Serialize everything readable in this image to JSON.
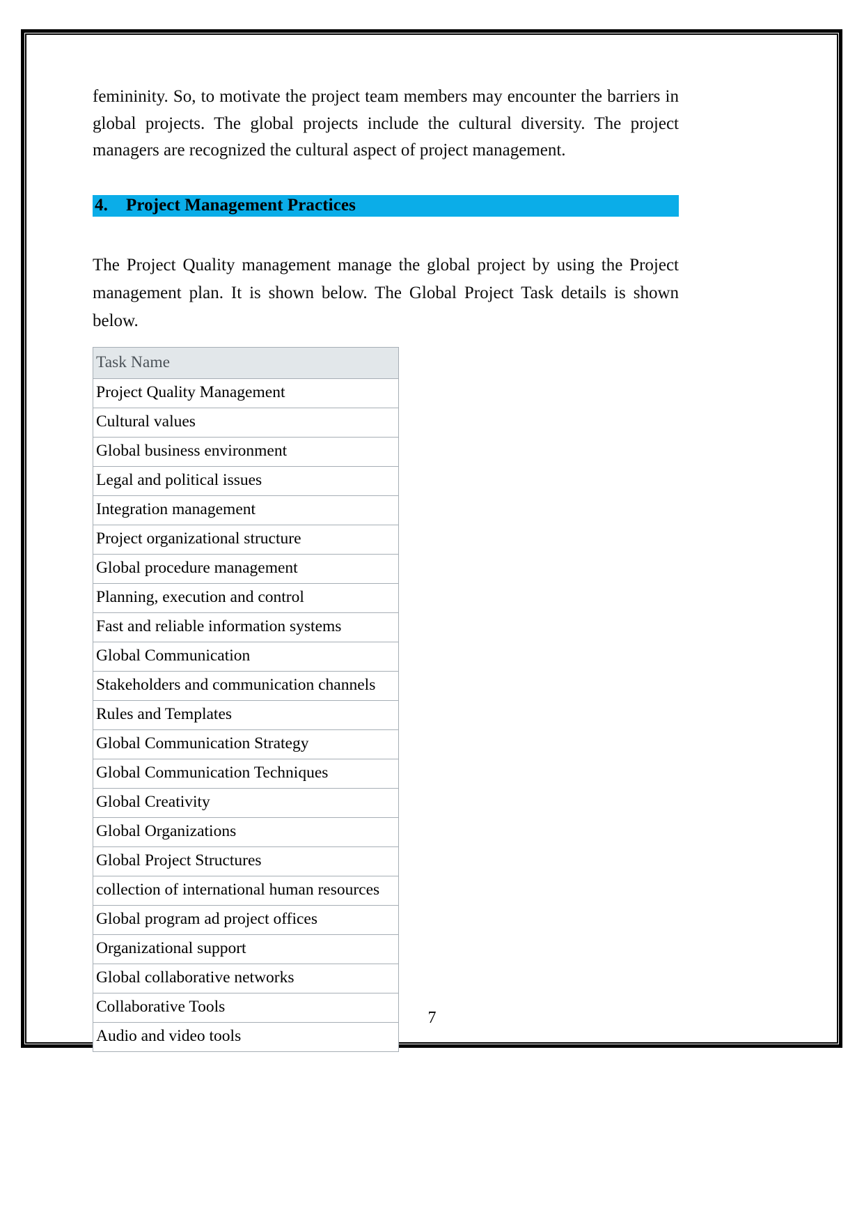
{
  "document": {
    "paragraphs": {
      "top": "femininity. So, to motivate the project team members may encounter the barriers in global projects. The global projects include the cultural diversity. The project managers are recognized the cultural aspect of project management.",
      "intro": "The Project Quality management manage the global project by using the Project management plan. It is shown below. The Global Project Task details is shown below."
    },
    "heading": {
      "number": "4.",
      "text": "Project Management Practices",
      "highlight_color": "#0BADE8"
    },
    "page_number": "7"
  },
  "task_table": {
    "header": "Task Name",
    "header_background": "#E2E7EA",
    "header_text_color": "#4A5157",
    "border_color": "#A6AEB5",
    "rows": [
      {
        "label": "Project Quality Management",
        "level": 0,
        "bold": true
      },
      {
        "label": "Cultural values",
        "level": 1,
        "bold": false
      },
      {
        "label": "Global business environment",
        "level": 1,
        "bold": false
      },
      {
        "label": "Legal and political issues",
        "level": 1,
        "bold": false
      },
      {
        "label": "Integration management",
        "level": 1,
        "bold": false
      },
      {
        "label": "Project organizational structure",
        "level": 1,
        "bold": false
      },
      {
        "label": "Global procedure management",
        "level": 1,
        "bold": false
      },
      {
        "label": "Planning, execution and control",
        "level": 1,
        "bold": false
      },
      {
        "label": "Fast and reliable information systems",
        "level": 1,
        "bold": false
      },
      {
        "label": "Global Communication",
        "level": 1,
        "bold": true
      },
      {
        "label": "Stakeholders and communication channels",
        "level": 2,
        "bold": false
      },
      {
        "label": "Rules and Templates",
        "level": 2,
        "bold": false
      },
      {
        "label": "Global Communication Strategy",
        "level": 2,
        "bold": false
      },
      {
        "label": "Global Communication Techniques",
        "level": 2,
        "bold": false
      },
      {
        "label": "Global Creativity",
        "level": 2,
        "bold": false
      },
      {
        "label": "Global Organizations",
        "level": 1,
        "bold": true
      },
      {
        "label": "Global Project Structures",
        "level": 2,
        "bold": false
      },
      {
        "label": "collection of international human resources",
        "level": 2,
        "bold": false
      },
      {
        "label": "Global program ad project offices",
        "level": 2,
        "bold": false
      },
      {
        "label": "Organizational support",
        "level": 2,
        "bold": false
      },
      {
        "label": "Global collaborative networks",
        "level": 2,
        "bold": false
      },
      {
        "label": "Collaborative Tools",
        "level": 1,
        "bold": true
      },
      {
        "label": "Audio and video tools",
        "level": 2,
        "bold": false
      }
    ]
  }
}
